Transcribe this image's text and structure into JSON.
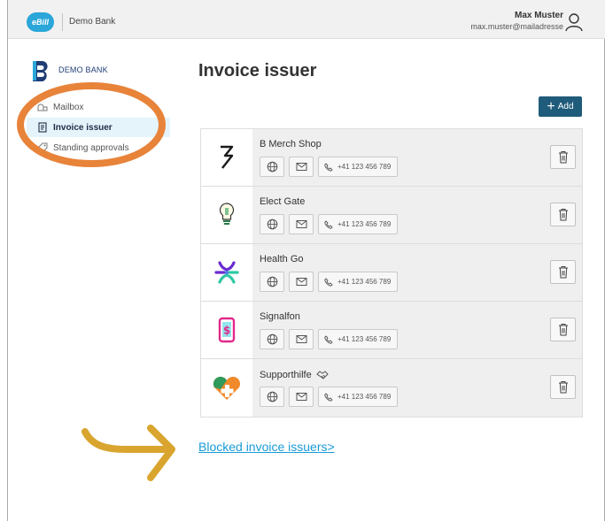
{
  "topbar": {
    "app_logo_text": "eBill",
    "bank_label": "Demo Bank",
    "user_name": "Max Muster",
    "user_email": "max.muster@mailadresse",
    "user_icon": "person-icon"
  },
  "sidebar": {
    "brand_name": "DEMO BANK",
    "items": [
      {
        "label": "Mailbox",
        "icon": "mailbox-icon",
        "active": false
      },
      {
        "label": "Invoice issuer",
        "icon": "document-icon",
        "active": true
      },
      {
        "label": "Standing approvals",
        "icon": "tag-icon",
        "active": false
      }
    ]
  },
  "main": {
    "title": "Invoice issuer",
    "add_label": "Add",
    "issuers": [
      {
        "name": "B Merch Shop",
        "phone": "+41 123 456 789"
      },
      {
        "name": "Elect Gate",
        "phone": "+41 123 456 789"
      },
      {
        "name": "Health Go",
        "phone": "+41 123 456 789"
      },
      {
        "name": "Signalfon",
        "phone": "+41 123 456 789"
      },
      {
        "name": "Supporthilfe",
        "phone": "+41 123 456 789"
      }
    ],
    "blocked_link": "Blocked invoice issuers>"
  },
  "colors": {
    "accent": "#1f5b7a",
    "link": "#1a9bd7",
    "annotation_ellipse": "#e8833a",
    "annotation_arrow": "#d9a52e",
    "active_item_bg": "#e5f4fb"
  }
}
